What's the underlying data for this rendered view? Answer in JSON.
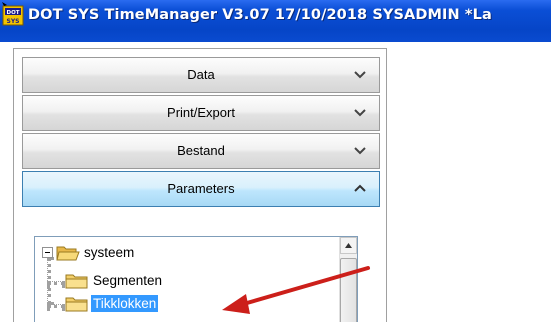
{
  "window": {
    "app_icon_text": "DOT\nSYS",
    "title": "DOT SYS TimeManager V3.07 17/10/2018 SYSADMIN  *La"
  },
  "sections": [
    {
      "label": "Data",
      "state": "collapsed",
      "chevron_icon": "chevron-down-icon"
    },
    {
      "label": "Print/Export",
      "state": "collapsed",
      "chevron_icon": "chevron-down-icon"
    },
    {
      "label": "Bestand",
      "state": "collapsed",
      "chevron_icon": "chevron-down-icon"
    },
    {
      "label": "Parameters",
      "state": "expanded",
      "chevron_icon": "chevron-up-icon"
    }
  ],
  "tree": {
    "root": {
      "label": "systeem",
      "expander": "minus",
      "icon": "folder-open-icon"
    },
    "children": [
      {
        "label": "Segmenten",
        "icon": "folder-icon",
        "selected": false
      },
      {
        "label": "Tikklokken",
        "icon": "folder-icon",
        "selected": true
      }
    ]
  },
  "colors": {
    "titlebar": "#0a4bd0",
    "active_section": "#bee6fd",
    "selection": "#3399ff",
    "annotation_arrow": "#cc1f1a"
  }
}
